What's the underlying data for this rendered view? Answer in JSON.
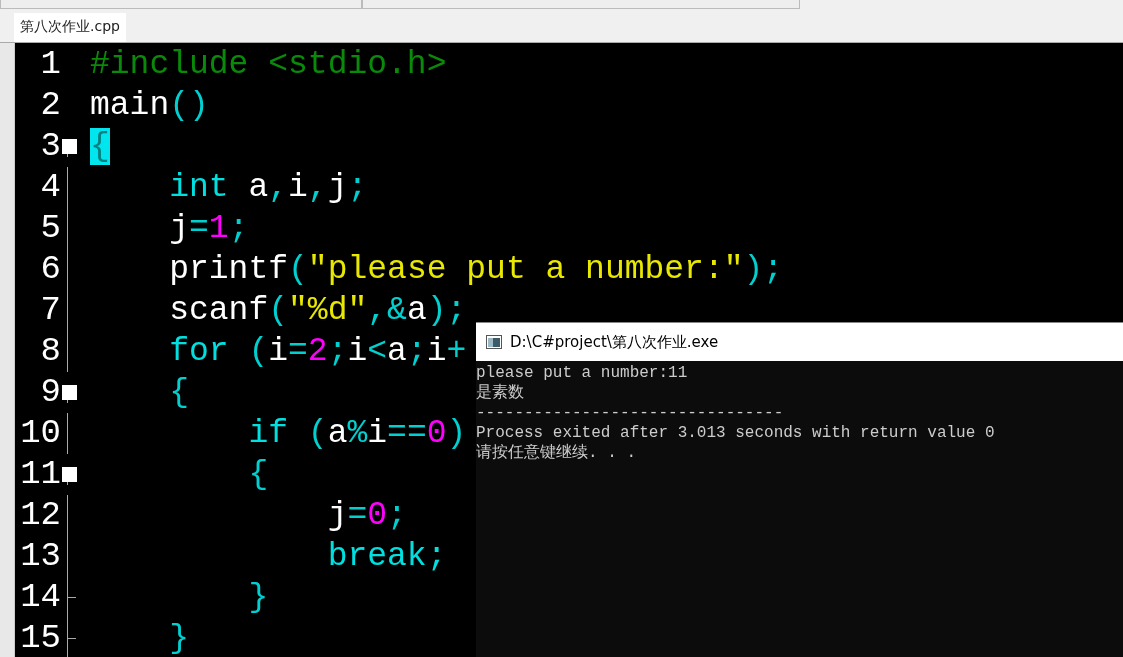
{
  "tabs": [
    {
      "label": "第八次作业.cpp",
      "selected": true
    }
  ],
  "editor": {
    "lines": [
      {
        "number": "1",
        "tokens": [
          {
            "text": "#include <stdio.h>",
            "kind": "preproc"
          }
        ]
      },
      {
        "number": "2",
        "tokens": [
          {
            "text": "main",
            "kind": "plain"
          },
          {
            "text": "()",
            "kind": "punct"
          }
        ]
      },
      {
        "number": "3",
        "fold_start": true,
        "tokens": [
          {
            "text": "{",
            "kind": "punct",
            "highlighted": true
          }
        ]
      },
      {
        "number": "4",
        "tokens": [
          {
            "text": "    int",
            "kind": "keyword"
          },
          {
            "text": " a",
            "kind": "plain"
          },
          {
            "text": ",",
            "kind": "punct"
          },
          {
            "text": "i",
            "kind": "plain"
          },
          {
            "text": ",",
            "kind": "punct"
          },
          {
            "text": "j",
            "kind": "plain"
          },
          {
            "text": ";",
            "kind": "punct"
          }
        ]
      },
      {
        "number": "5",
        "tokens": [
          {
            "text": "    j",
            "kind": "plain"
          },
          {
            "text": "=",
            "kind": "punct"
          },
          {
            "text": "1",
            "kind": "number"
          },
          {
            "text": ";",
            "kind": "punct"
          }
        ]
      },
      {
        "number": "6",
        "tokens": [
          {
            "text": "    printf",
            "kind": "plain"
          },
          {
            "text": "(",
            "kind": "punct"
          },
          {
            "text": "\"please put a number:\"",
            "kind": "string"
          },
          {
            "text": ");",
            "kind": "punct"
          }
        ]
      },
      {
        "number": "7",
        "tokens": [
          {
            "text": "    scanf",
            "kind": "plain"
          },
          {
            "text": "(",
            "kind": "punct"
          },
          {
            "text": "\"%d\"",
            "kind": "string"
          },
          {
            "text": ",&",
            "kind": "punct"
          },
          {
            "text": "a",
            "kind": "plain"
          },
          {
            "text": ");",
            "kind": "punct"
          }
        ]
      },
      {
        "number": "8",
        "tokens": [
          {
            "text": "    for",
            "kind": "keyword"
          },
          {
            "text": " (",
            "kind": "punct"
          },
          {
            "text": "i",
            "kind": "plain"
          },
          {
            "text": "=",
            "kind": "punct"
          },
          {
            "text": "2",
            "kind": "number"
          },
          {
            "text": ";",
            "kind": "punct"
          },
          {
            "text": "i",
            "kind": "plain"
          },
          {
            "text": "<",
            "kind": "punct"
          },
          {
            "text": "a",
            "kind": "plain"
          },
          {
            "text": ";",
            "kind": "punct"
          },
          {
            "text": "i",
            "kind": "plain"
          },
          {
            "text": "+",
            "kind": "punct"
          }
        ]
      },
      {
        "number": "9",
        "fold_start": true,
        "tokens": [
          {
            "text": "    {",
            "kind": "punct"
          }
        ]
      },
      {
        "number": "10",
        "tokens": [
          {
            "text": "        if",
            "kind": "keyword"
          },
          {
            "text": " (",
            "kind": "punct"
          },
          {
            "text": "a",
            "kind": "plain"
          },
          {
            "text": "%",
            "kind": "punct"
          },
          {
            "text": "i",
            "kind": "plain"
          },
          {
            "text": "==",
            "kind": "punct"
          },
          {
            "text": "0",
            "kind": "number"
          },
          {
            "text": ")",
            "kind": "punct"
          }
        ]
      },
      {
        "number": "11",
        "fold_start": true,
        "tokens": [
          {
            "text": "        {",
            "kind": "punct"
          }
        ]
      },
      {
        "number": "12",
        "tokens": [
          {
            "text": "            j",
            "kind": "plain"
          },
          {
            "text": "=",
            "kind": "punct"
          },
          {
            "text": "0",
            "kind": "number"
          },
          {
            "text": ";",
            "kind": "punct"
          }
        ]
      },
      {
        "number": "13",
        "tokens": [
          {
            "text": "            break;",
            "kind": "keyword"
          }
        ]
      },
      {
        "number": "14",
        "fold_end": true,
        "tokens": [
          {
            "text": "        }",
            "kind": "punct"
          }
        ]
      },
      {
        "number": "15",
        "fold_end": true,
        "tokens": [
          {
            "text": "    }",
            "kind": "punct"
          }
        ]
      }
    ]
  },
  "console": {
    "title": "D:\\C#project\\第八次作业.exe",
    "lines": [
      "please put a number:11",
      "是素数",
      "--------------------------------",
      "Process exited after 3.013 seconds with return value 0",
      "请按任意键继续. . ."
    ]
  }
}
